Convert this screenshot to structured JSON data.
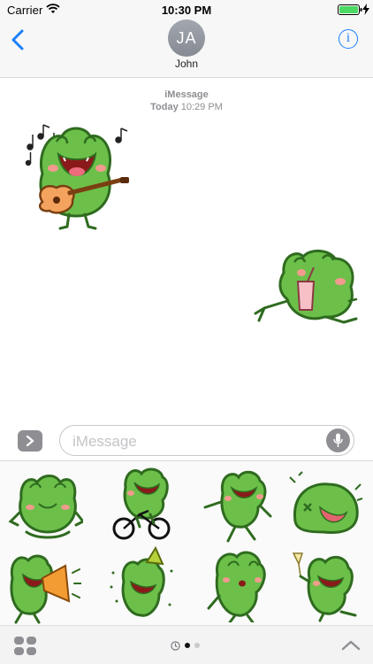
{
  "status_bar": {
    "carrier": "Carrier",
    "time": "10:30 PM",
    "wifi_icon": "wifi-icon",
    "battery_icon": "battery-full-icon",
    "charging_icon": "bolt-icon",
    "battery_color": "#4cd964"
  },
  "header": {
    "back_icon": "chevron-left-icon",
    "avatar_initials": "JA",
    "contact_name": "John",
    "info_label": "i",
    "accent_color": "#1a7ffb"
  },
  "conversation": {
    "service": "iMessage",
    "date_label": "Today",
    "time_label": "10:29 PM",
    "stickers": [
      {
        "name": "frog-singing-guitar-sticker"
      },
      {
        "name": "frog-lounging-drink-sticker"
      }
    ]
  },
  "input": {
    "placeholder": "iMessage",
    "apps_icon": "chevron-right-icon",
    "mic_icon": "microphone-icon"
  },
  "sticker_drawer": {
    "stickers": [
      "frog-meditating-sticker",
      "frog-cycling-sticker",
      "frog-dancing-sticker",
      "frog-dizzy-sticker",
      "frog-megaphone-sticker",
      "frog-party-hat-sticker",
      "frog-whistling-sticker",
      "frog-champagne-sticker"
    ],
    "page_indicator": {
      "pages": 2,
      "current": 1,
      "recent_icon": "clock-icon"
    }
  },
  "bottom_bar": {
    "grid_icon": "app-grid-icon",
    "expand_icon": "chevron-up-icon"
  }
}
